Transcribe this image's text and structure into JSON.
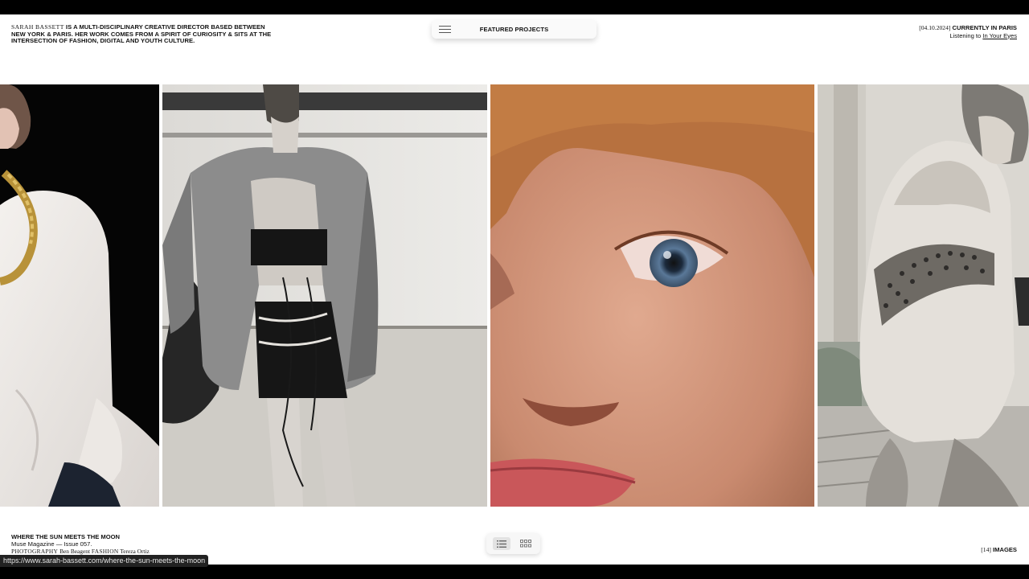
{
  "header": {
    "intro_name": "SARAH BASSETT",
    "intro_text": "IS A MULTI-DISCIPLINARY CREATIVE DIRECTOR BASED BETWEEN NEW YORK & PARIS. HER WORK COMES FROM A SPIRIT OF CURIOSITY & SITS AT THE INTERSECTION OF FASHION, DIGITAL AND YOUTH CULTURE.",
    "nav_label": "FEATURED PROJECTS",
    "menu_icon": "hamburger-icon"
  },
  "status": {
    "date": "[04.10.2024]",
    "city": "CURRENTLY IN PARIS",
    "listening_prefix": "Listening to",
    "song": "In Your Eyes"
  },
  "gallery": {
    "images": [
      {
        "name": "photo-model-chain-necklace"
      },
      {
        "name": "photo-model-lace-up-skirt"
      },
      {
        "name": "photo-closeup-face"
      },
      {
        "name": "photo-model-spiked-jacket"
      }
    ]
  },
  "project": {
    "title": "WHERE THE SUN MEETS THE MOON",
    "publication": "Muse Magazine — Issue 057.",
    "photography_label": "PHOTOGRAPHY",
    "photographer": "Ben Beagent",
    "fashion_label": "FASHION",
    "stylist": "Tereza Ortiz"
  },
  "view_toggle": {
    "list_icon": "list-view-icon",
    "grid_icon": "grid-view-icon",
    "active": "list"
  },
  "image_count": {
    "number": "[14]",
    "label": "IMAGES"
  },
  "status_url": "https://www.sarah-bassett.com/where-the-sun-meets-the-moon"
}
